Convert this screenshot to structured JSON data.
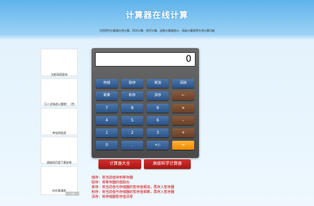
{
  "header": {
    "title": "计算器在线计算",
    "subtitle": "为您提供计算器在线计算、科学计算、程序计算、函数计算器统计、高级计算器等在线计算功能"
  },
  "sidebar": {
    "ads": [
      "光影萌萌登场",
      "万人全城战火重燃！（特",
      "单电网络游",
      "超级网页版下载安装",
      "玖玖看漫画"
    ],
    "ad_tag": "广告"
  },
  "calculator": {
    "display": "0",
    "rows": [
      [
        "存储",
        "取存",
        "累加",
        "清除"
      ],
      [
        "累乘",
        "积存",
        "清存",
        "←"
      ],
      [
        "7",
        "8",
        "9",
        "×"
      ],
      [
        "4",
        "5",
        "6",
        "-"
      ],
      [
        "1",
        "2",
        "3",
        "+"
      ],
      [
        "0",
        ".",
        "+/-",
        "="
      ]
    ]
  },
  "links": {
    "all_calculators": "计算器大全",
    "scientific": "高级科学计算器"
  },
  "notes": [
    "储存：将当前值存到寄存器",
    "取存：将寄存器的值取出",
    "累存：将当前值与存储器的暂存值相加，再存入暂存器",
    "积存：将当前值与存储器的暂存值相乘，再存入暂存器",
    "清存：将存储器暂存值清零"
  ],
  "colors": {
    "header_gradient": "#5fb3ec",
    "button_blue": "#3a63a0",
    "button_brown": "#7a4c32",
    "equals_orange": "#f5a11a",
    "link_red": "#c11f1c",
    "note_red": "#d00000"
  }
}
